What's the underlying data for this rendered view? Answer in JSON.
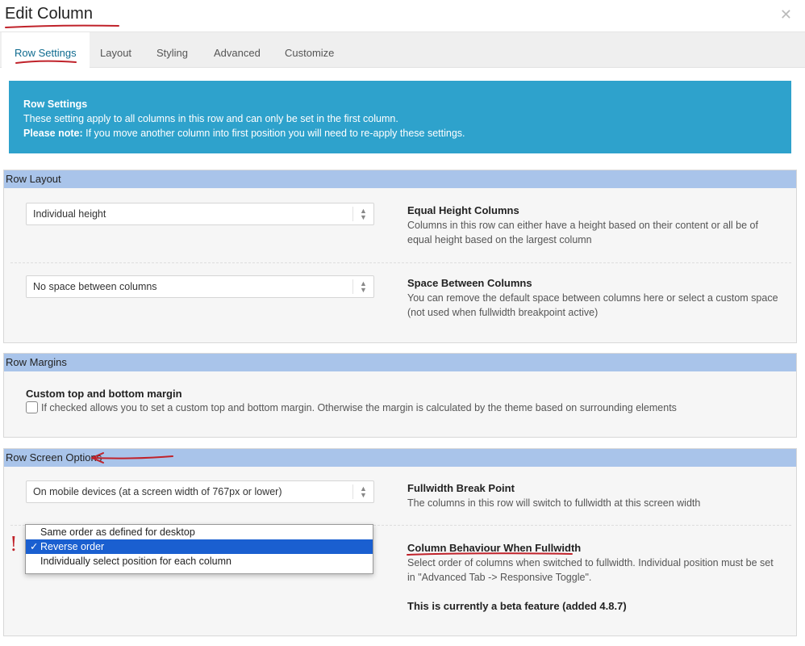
{
  "dialog": {
    "title": "Edit Column",
    "close_icon": "close-icon"
  },
  "tabs": [
    {
      "label": "Row Settings",
      "active": true
    },
    {
      "label": "Layout",
      "active": false
    },
    {
      "label": "Styling",
      "active": false
    },
    {
      "label": "Advanced",
      "active": false
    },
    {
      "label": "Customize",
      "active": false
    }
  ],
  "notice": {
    "title": "Row Settings",
    "line1": "These setting apply to all columns in this row and can only be set in the first column.",
    "note_label": "Please note:",
    "note_text": " If you move another column into first position you will need to re-apply these settings.",
    "color": "#2ea2cc"
  },
  "row_layout": {
    "header": "Row Layout",
    "equal_height": {
      "value": "Individual height",
      "title": "Equal Height Columns",
      "desc": "Columns in this row can either have a height based on their content or all be of equal height based on the largest column"
    },
    "space_between": {
      "value": "No space between columns",
      "title": "Space Between Columns",
      "desc": "You can remove the default space between columns here or select a custom space (not used when fullwidth breakpoint active)"
    }
  },
  "row_margins": {
    "header": "Row Margins",
    "checkbox_title": "Custom top and bottom margin",
    "checkbox_checked": false,
    "checkbox_desc": "If checked allows you to set a custom top and bottom margin. Otherwise the margin is calculated by the theme based on surrounding elements"
  },
  "row_screen": {
    "header": "Row Screen Options",
    "breakpoint": {
      "value": "On mobile devices (at a screen width of 767px or lower)",
      "title": "Fullwidth Break Point",
      "desc": "The columns in this row will switch to fullwidth at this screen width"
    },
    "behaviour": {
      "title": "Column Behaviour When Fullwidth",
      "desc": "Select order of columns when switched to fullwidth. Individual position must be set in \"Advanced Tab -> Responsive Toggle\".",
      "beta": "This is currently a beta feature (added 4.8.7)",
      "options": [
        {
          "label": "Same order as defined for desktop",
          "selected": false
        },
        {
          "label": "Reverse order",
          "selected": true
        },
        {
          "label": "Individually select position for each column",
          "selected": false
        }
      ],
      "check_mark": "✓"
    }
  },
  "annotations": {
    "exclamation": "!",
    "color": "#c0222a"
  }
}
